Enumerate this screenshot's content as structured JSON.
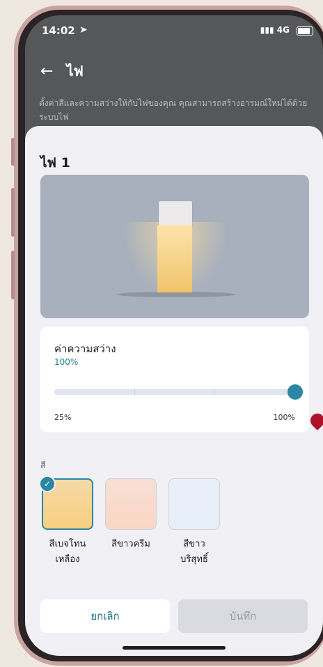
{
  "status_bar": {
    "time": "14:02",
    "location_icon": "location-arrow",
    "network": "4G"
  },
  "nav": {
    "back_icon": "back-arrow",
    "title": "ไฟ"
  },
  "description": "ตั้งค่าสีและความสว่างให้กับไฟของคุณ คุณสามารถสร้างอารมณ์ใหม่ได้ด้วยระบบไฟ",
  "light": {
    "name": "ไฟ 1"
  },
  "brightness": {
    "label": "ค่าความสว่าง",
    "value_text": "100%",
    "value": 100,
    "min_label": "25%",
    "max_label": "100%"
  },
  "color": {
    "heading": "สี",
    "options": [
      {
        "name_line1": "สีเบจโทน",
        "name_line2": "เหลือง",
        "swatch": "#f7cf7f",
        "selected": true
      },
      {
        "name_line1": "สีขาวครีม",
        "name_line2": "",
        "swatch": "#fbd6c4",
        "selected": false
      },
      {
        "name_line1": "สีขาว",
        "name_line2": "บริสุทธิ์",
        "swatch": "#e6eef9",
        "selected": false
      }
    ]
  },
  "actions": {
    "cancel": "ยกเลิก",
    "save": "บันทึก"
  },
  "colors": {
    "accent": "#2a86a3",
    "sheet_bg": "#f0f0f5",
    "preview_bg": "#a8b0bd"
  }
}
